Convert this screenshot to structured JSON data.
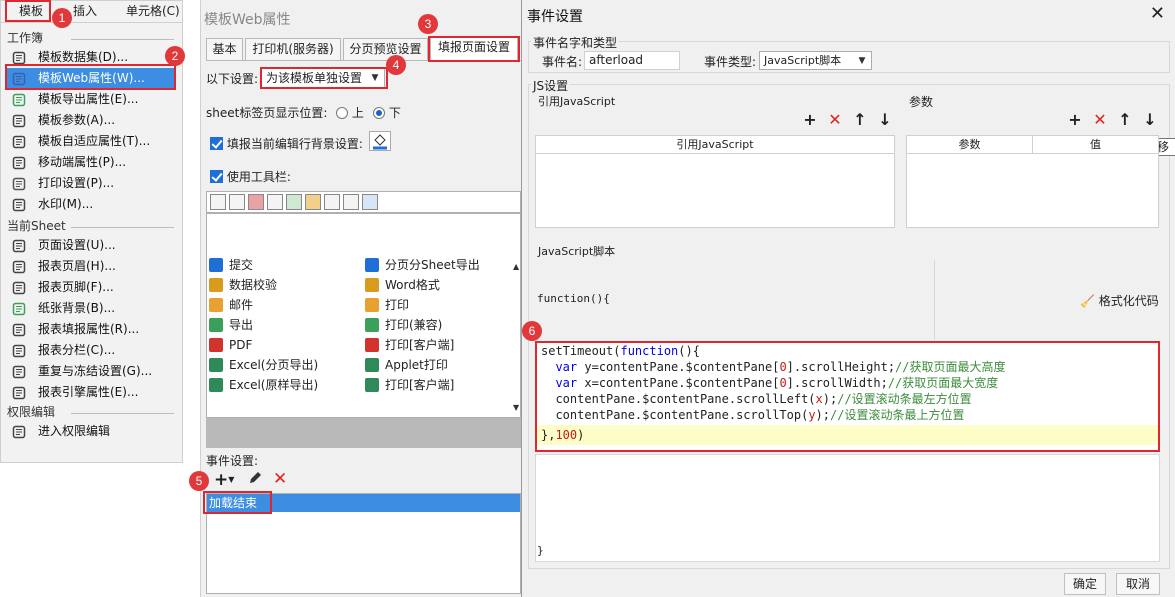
{
  "menu": {
    "tabs": [
      "模板",
      "插入",
      "单元格(C)"
    ],
    "section_workbook": "工作簿",
    "workbook_items": [
      {
        "label": "模板数据集(D)...",
        "icon": "database-icon"
      },
      {
        "label": "模板Web属性(W)...",
        "icon": "globe-icon",
        "selected": true
      },
      {
        "label": "模板导出属性(E)...",
        "icon": "export-icon"
      },
      {
        "label": "模板参数(A)...",
        "icon": "parameter-icon"
      },
      {
        "label": "模板自适应属性(T)...",
        "icon": "adaptive-icon"
      },
      {
        "label": "移动端属性(P)...",
        "icon": "mobile-icon"
      },
      {
        "label": "打印设置(P)...",
        "icon": "printer-icon"
      },
      {
        "label": "水印(M)...",
        "icon": "stamp-icon"
      }
    ],
    "section_sheet": "当前Sheet",
    "sheet_items": [
      {
        "label": "页面设置(U)...",
        "icon": "page-setup-icon"
      },
      {
        "label": "报表页眉(H)...",
        "icon": "header-icon"
      },
      {
        "label": "报表页脚(F)...",
        "icon": "footer-icon"
      },
      {
        "label": "纸张背景(B)...",
        "icon": "image-icon"
      },
      {
        "label": "报表填报属性(R)...",
        "icon": "form-icon"
      },
      {
        "label": "报表分栏(C)...",
        "icon": "columns-icon"
      },
      {
        "label": "重复与冻结设置(G)...",
        "icon": "freeze-icon"
      },
      {
        "label": "报表引擎属性(E)...",
        "icon": "engine-icon"
      }
    ],
    "section_perm": "权限编辑",
    "perm_items": [
      {
        "label": "进入权限编辑",
        "icon": "permission-icon"
      }
    ]
  },
  "web_dialog": {
    "title": "模板Web属性",
    "tabs": [
      "基本",
      "打印机(服务器)",
      "分页预览设置",
      "填报页面设置"
    ],
    "active_tab": "填报页面设置",
    "settings_label": "以下设置:",
    "settings_value": "为该模板单独设置",
    "sheet_tab_label": "sheet标签页显示位置:",
    "radio_top": "上",
    "radio_bottom": "下",
    "fill_bg_label": "填报当前编辑行背景设置:",
    "use_toolbar_label": "使用工具栏:",
    "buttons_left": [
      "提交",
      "数据校验",
      "邮件",
      "导出",
      "PDF",
      "Excel(分页导出)",
      "Excel(原样导出)"
    ],
    "buttons_right": [
      "分页分Sheet导出",
      "Word格式",
      "打印",
      "打印(兼容)",
      "打印[客户端]",
      "Applet打印",
      "打印[客户端]"
    ],
    "event_label": "事件设置:",
    "event_item": "加载结束"
  },
  "event_dialog": {
    "title": "事件设置",
    "group_name_type": "事件名字和类型",
    "event_name_label": "事件名:",
    "event_name_value": "afterload",
    "event_type_label": "事件类型:",
    "event_type_value": "JavaScript脚本",
    "group_js": "JS设置",
    "ref_js_label": "引用JavaScript",
    "params_label": "参数",
    "ref_js_col": "引用JavaScript",
    "param_col": "参数",
    "value_col": "值",
    "tooltip": "下移",
    "js_script_label": "JavaScript脚本",
    "func_header": "function(){",
    "format_code": "格式化代码",
    "code_lines": [
      "setTimeout(function(){",
      "  var y=contentPane.$contentPane[0].scrollHeight;//获取页面最大高度",
      "  var x=contentPane.$contentPane[0].scrollWidth;//获取页面最大宽度",
      "  contentPane.$contentPane.scrollLeft(x);//设置滚动条最左方位置",
      "  contentPane.$contentPane.scrollTop(y);//设置滚动条最上方位置",
      "},100)"
    ],
    "func_footer": "}",
    "ok": "确定",
    "cancel": "取消"
  },
  "badges": [
    "1",
    "2",
    "3",
    "4",
    "5",
    "6"
  ],
  "colors": {
    "highlight": "#e0272f",
    "selection": "#3d8ee2",
    "badge": "#e0383b"
  }
}
